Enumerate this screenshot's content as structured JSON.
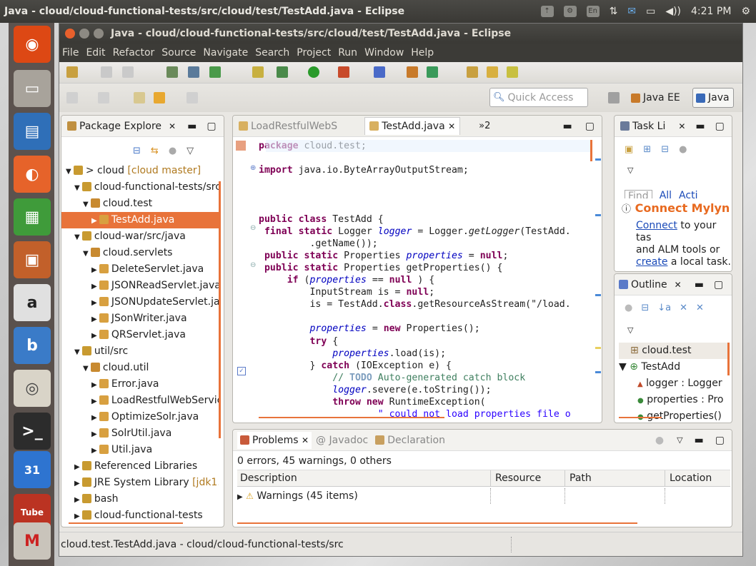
{
  "os": {
    "title": "Java - cloud/cloud-functional-tests/src/cloud/test/TestAdd.java - Eclipse",
    "keyboard": "En",
    "time": "4:21 PM"
  },
  "window": {
    "title": "Java - cloud/cloud-functional-tests/src/cloud/test/TestAdd.java - Eclipse"
  },
  "menu": [
    "File",
    "Edit",
    "Refactor",
    "Source",
    "Navigate",
    "Search",
    "Project",
    "Run",
    "Window",
    "Help"
  ],
  "quick_access": {
    "placeholder": "Quick Access"
  },
  "perspectives": [
    "Java EE",
    "Java"
  ],
  "package_explorer": {
    "title": "Package Explore",
    "items": [
      {
        "label": "> cloud",
        "extra": "[cloud master]",
        "depth": 0,
        "twisty": "▼"
      },
      {
        "label": "cloud-functional-tests/src",
        "depth": 1,
        "twisty": "▼"
      },
      {
        "label": "cloud.test",
        "depth": 2,
        "twisty": "▼"
      },
      {
        "label": "TestAdd.java",
        "depth": 3,
        "twisty": "▶",
        "selected": true
      },
      {
        "label": "cloud-war/src/java",
        "depth": 1,
        "twisty": "▼"
      },
      {
        "label": "cloud.servlets",
        "depth": 2,
        "twisty": "▼"
      },
      {
        "label": "DeleteServlet.java",
        "depth": 3,
        "twisty": "▶"
      },
      {
        "label": "JSONReadServlet.java",
        "depth": 3,
        "twisty": "▶"
      },
      {
        "label": "JSONUpdateServlet.java",
        "depth": 3,
        "twisty": "▶"
      },
      {
        "label": "JSonWriter.java",
        "depth": 3,
        "twisty": "▶"
      },
      {
        "label": "QRServlet.java",
        "depth": 3,
        "twisty": "▶"
      },
      {
        "label": "util/src",
        "depth": 1,
        "twisty": "▼"
      },
      {
        "label": "cloud.util",
        "depth": 2,
        "twisty": "▼"
      },
      {
        "label": "Error.java",
        "depth": 3,
        "twisty": "▶"
      },
      {
        "label": "LoadRestfulWebService.java",
        "depth": 3,
        "twisty": "▶"
      },
      {
        "label": "OptimizeSolr.java",
        "depth": 3,
        "twisty": "▶"
      },
      {
        "label": "SolrUtil.java",
        "depth": 3,
        "twisty": "▶"
      },
      {
        "label": "Util.java",
        "depth": 3,
        "twisty": "▶"
      },
      {
        "label": "Referenced Libraries",
        "depth": 1,
        "twisty": "▶"
      },
      {
        "label": "JRE System Library",
        "extra": "[jdk1.7",
        "depth": 1,
        "twisty": "▶"
      },
      {
        "label": "bash",
        "depth": 1,
        "twisty": "▶"
      },
      {
        "label": "cloud-functional-tests",
        "depth": 1,
        "twisty": "▶"
      }
    ]
  },
  "editor": {
    "tabs": [
      "LoadRestfulWebS",
      "TestAdd.java"
    ],
    "overflow": "»2",
    "lines": [
      [
        [
          "kw",
          "package"
        ],
        [
          "",
          "cloud.test;"
        ]
      ],
      [],
      [
        [
          "kw",
          "import"
        ],
        [
          "",
          "java.io.ByteArrayOutputStream;"
        ]
      ],
      [],
      [],
      [],
      [
        [
          "kw",
          "public class"
        ],
        [
          "",
          " TestAdd {"
        ]
      ],
      [
        [
          "",
          " "
        ],
        [
          "kw",
          "final static"
        ],
        [
          "",
          " Logger "
        ],
        [
          "fld",
          "logger"
        ],
        [
          "",
          " = Logger."
        ],
        [
          "it",
          "getLogger"
        ],
        [
          "",
          "(TestAdd."
        ]
      ],
      [
        [
          "",
          "         .getName());"
        ]
      ],
      [
        [
          "",
          " "
        ],
        [
          "kw",
          "public static"
        ],
        [
          "",
          " Properties "
        ],
        [
          "fld",
          "properties"
        ],
        [
          "",
          " = "
        ],
        [
          "kw",
          "null"
        ],
        [
          "",
          ";"
        ]
      ],
      [
        [
          "",
          " "
        ],
        [
          "kw",
          "public static"
        ],
        [
          "",
          " Properties getProperties() {"
        ]
      ],
      [
        [
          "",
          "     "
        ],
        [
          "kw",
          "if"
        ],
        [
          "",
          " ("
        ],
        [
          "fld",
          "properties"
        ],
        [
          "",
          " == "
        ],
        [
          "kw",
          "null"
        ],
        [
          "",
          ") {"
        ]
      ],
      [
        [
          "",
          "         InputStream is = "
        ],
        [
          "kw",
          "null"
        ],
        [
          "",
          ";"
        ]
      ],
      [
        [
          "",
          "         is = TestAdd."
        ],
        [
          "kw",
          "class"
        ],
        [
          "",
          ".getResourceAsStream(\"/load."
        ]
      ],
      [],
      [
        [
          "",
          "         "
        ],
        [
          "fld",
          "properties"
        ],
        [
          "",
          " = "
        ],
        [
          "kw",
          "new"
        ],
        [
          "",
          " Properties();"
        ]
      ],
      [
        [
          "",
          "         "
        ],
        [
          "kw",
          "try"
        ],
        [
          "",
          " {"
        ]
      ],
      [
        [
          "",
          "             "
        ],
        [
          "fld",
          "properties"
        ],
        [
          "",
          ".load(is);"
        ]
      ],
      [
        [
          "",
          "         } "
        ],
        [
          "kw",
          "catch"
        ],
        [
          "",
          " (IOException e) {"
        ]
      ],
      [
        [
          "",
          "             "
        ],
        [
          "cmt",
          "// "
        ],
        [
          "todo",
          "TODO"
        ],
        [
          "cmt",
          " Auto-generated catch block"
        ]
      ],
      [
        [
          "",
          "             "
        ],
        [
          "fld",
          "logger"
        ],
        [
          "",
          ".severe(e.toString());"
        ]
      ],
      [
        [
          "",
          "             "
        ],
        [
          "kw",
          "throw new"
        ],
        [
          "",
          " RuntimeException("
        ]
      ],
      [
        [
          "",
          "                     "
        ],
        [
          "str",
          "\" could not load properties file o"
        ]
      ]
    ]
  },
  "task_list": {
    "title": "Task Li",
    "find": "Find",
    "all": "All",
    "acti": "Acti",
    "mylyn_title": "Connect Mylyn",
    "mylyn_connect": "Connect",
    "mylyn_text1": " to your tas",
    "mylyn_text2": "and ALM tools or",
    "mylyn_create": "create",
    "mylyn_text3": " a local task."
  },
  "outline": {
    "title": "Outline",
    "items": [
      "cloud.test",
      "TestAdd",
      "logger : Logger",
      "properties : Pro",
      "getProperties()"
    ]
  },
  "problems": {
    "tabs": [
      "Problems",
      "Javadoc",
      "Declaration"
    ],
    "summary": "0 errors, 45 warnings, 0 others",
    "columns": [
      "Description",
      "Resource",
      "Path",
      "Location"
    ],
    "row": "Warnings (45 items)"
  },
  "status": {
    "text": "cloud.test.TestAdd.java - cloud/cloud-functional-tests/src"
  }
}
